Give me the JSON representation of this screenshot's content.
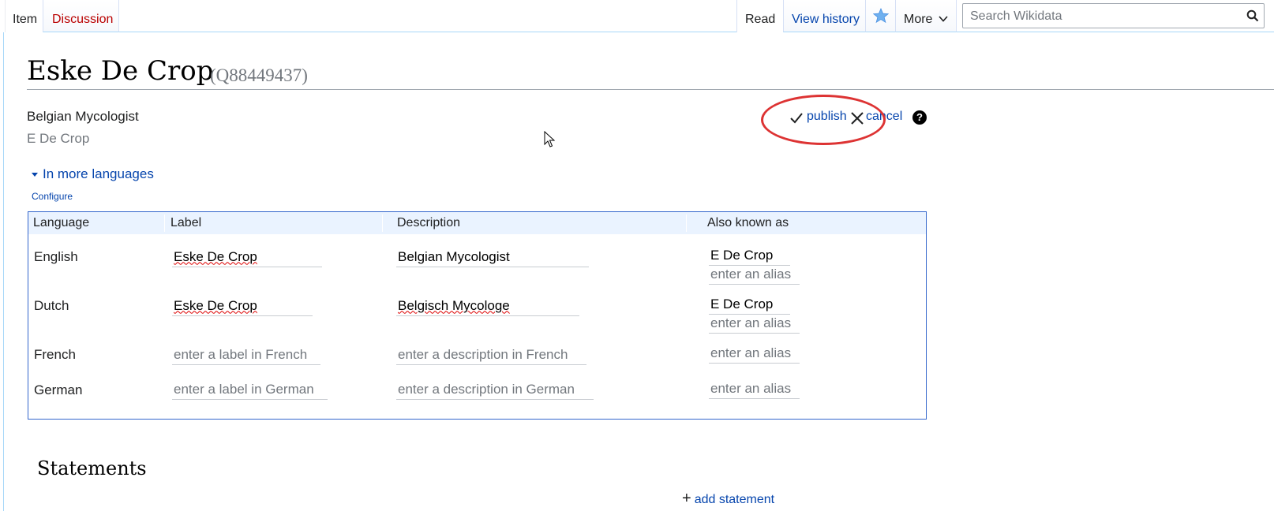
{
  "tabs": {
    "item": "Item",
    "discussion": "Discussion",
    "read": "Read",
    "view_history": "View history",
    "more": "More"
  },
  "search": {
    "placeholder": "Search Wikidata"
  },
  "entity": {
    "title": "Eske De Crop",
    "id": "(Q88449437)",
    "description": "Belgian Mycologist",
    "alias": "E De Crop"
  },
  "toolbar": {
    "publish": "publish",
    "cancel": "cancel",
    "help": "?"
  },
  "more_languages": {
    "toggle": "In more languages",
    "configure": "Configure"
  },
  "lang_table": {
    "headers": {
      "language": "Language",
      "label": "Label",
      "description": "Description",
      "aliases": "Also known as"
    },
    "rows": [
      {
        "language": "English",
        "label": "Eske De Crop",
        "description": "Belgian Mycologist",
        "alias": "E De Crop",
        "alias_placeholder": "enter an alias"
      },
      {
        "language": "Dutch",
        "label": "Eske De Crop",
        "description": "Belgisch Mycologe",
        "alias": "E De Crop",
        "alias_placeholder": "enter an alias"
      },
      {
        "language": "French",
        "label_placeholder": "enter a label in French",
        "description_placeholder": "enter a description in French",
        "alias_placeholder": "enter an alias"
      },
      {
        "language": "German",
        "label_placeholder": "enter a label in German",
        "description_placeholder": "enter a description in German",
        "alias_placeholder": "enter an alias"
      }
    ]
  },
  "statements": {
    "heading": "Statements",
    "add": "add statement"
  },
  "colors": {
    "link": "#0645ad",
    "discussion_red": "#ba0000",
    "highlight_ellipse": "#dd3333",
    "table_border": "#3366cc"
  }
}
